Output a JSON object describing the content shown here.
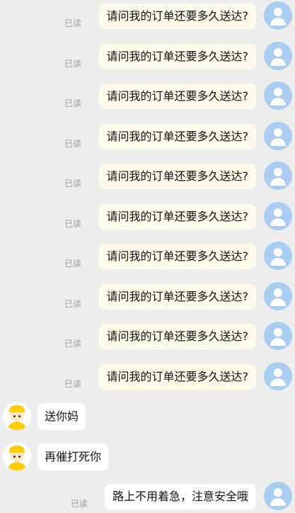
{
  "chat": {
    "outgoing": [
      {
        "text": "请问我的订单还要多久送达?",
        "status": "已读"
      },
      {
        "text": "请问我的订单还要多久送达?",
        "status": "已读"
      },
      {
        "text": "请问我的订单还要多久送达?",
        "status": "已读"
      },
      {
        "text": "请问我的订单还要多久送达?",
        "status": "已读"
      },
      {
        "text": "请问我的订单还要多久送达?",
        "status": "已读"
      },
      {
        "text": "请问我的订单还要多久送达?",
        "status": "已读"
      },
      {
        "text": "请问我的订单还要多久送达?",
        "status": "已读"
      },
      {
        "text": "请问我的订单还要多久送达?",
        "status": "已读"
      },
      {
        "text": "请问我的订单还要多久送达?",
        "status": "已读"
      },
      {
        "text": "请问我的订单还要多久送达?",
        "status": "已读"
      }
    ],
    "incoming": [
      {
        "text": "送你妈"
      },
      {
        "text": "再催打死你"
      }
    ],
    "last_outgoing": {
      "text": "路上不用着急，注意安全哦",
      "status": "已读"
    }
  },
  "icons": {
    "user_avatar": "user-avatar-icon",
    "rider_avatar": "rider-avatar-icon"
  },
  "colors": {
    "background": "#ededed",
    "outgoing_bubble": "#fdfbe9",
    "incoming_bubble": "#ffffff",
    "user_avatar": "#a9cdf0",
    "rider_accent": "#ffcc00"
  }
}
